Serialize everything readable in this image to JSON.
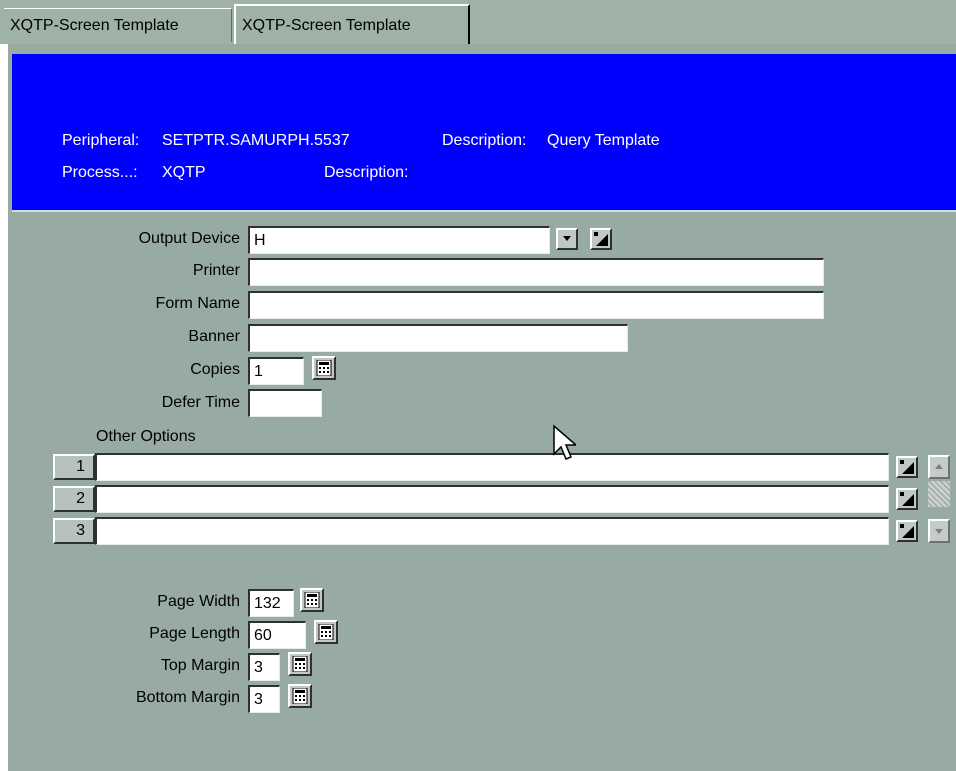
{
  "tabs": [
    {
      "label": "XQTP-Screen Template"
    },
    {
      "label": "XQTP-Screen Template"
    }
  ],
  "header": {
    "peripheral_label": "Peripheral:",
    "peripheral_value": "SETPTR.SAMURPH.5537",
    "peripheral_desc_label": "Description:",
    "peripheral_desc_value": "Query Template",
    "process_label": "Process...:",
    "process_value": "XQTP",
    "process_desc_label": "Description:",
    "process_desc_value": ""
  },
  "form": {
    "output_device": {
      "label": "Output Device",
      "value": "H"
    },
    "printer": {
      "label": "Printer",
      "value": ""
    },
    "form_name": {
      "label": "Form Name",
      "value": ""
    },
    "banner": {
      "label": "Banner",
      "value": ""
    },
    "copies": {
      "label": "Copies",
      "value": "1"
    },
    "defer_time": {
      "label": "Defer Time",
      "value": ""
    },
    "other_options": {
      "label": "Other Options",
      "rows": [
        {
          "number": "1",
          "value": ""
        },
        {
          "number": "2",
          "value": ""
        },
        {
          "number": "3",
          "value": ""
        }
      ]
    },
    "page_width": {
      "label": "Page Width",
      "value": "132"
    },
    "page_length": {
      "label": "Page Length",
      "value": "60"
    },
    "top_margin": {
      "label": "Top Margin",
      "value": "3"
    },
    "bottom_margin": {
      "label": "Bottom Margin",
      "value": "3"
    }
  },
  "icons": {
    "dropdown": "chevron-down-icon",
    "lookup": "lookup-icon",
    "calculator": "calculator-icon",
    "scroll_up": "arrow-up-icon",
    "scroll_down": "arrow-down-icon",
    "cursor": "mouse-pointer-icon"
  },
  "colors": {
    "header_bg": "#0000ff",
    "panel_bg": "#97aba2"
  }
}
